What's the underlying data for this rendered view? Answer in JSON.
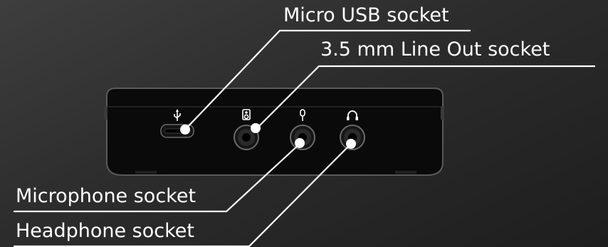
{
  "callouts": {
    "micro_usb": "Micro USB socket",
    "line_out": "3.5 mm Line Out socket",
    "microphone": "Microphone socket",
    "headphone": "Headphone socket"
  },
  "icons": [
    "usb-icon",
    "speaker-icon",
    "microphone-icon",
    "headphone-icon"
  ],
  "colors": {
    "background": "#2c2c2c",
    "device": "#0a0a0a",
    "callout_line": "#ffffff",
    "label_text": "#ffffff"
  }
}
